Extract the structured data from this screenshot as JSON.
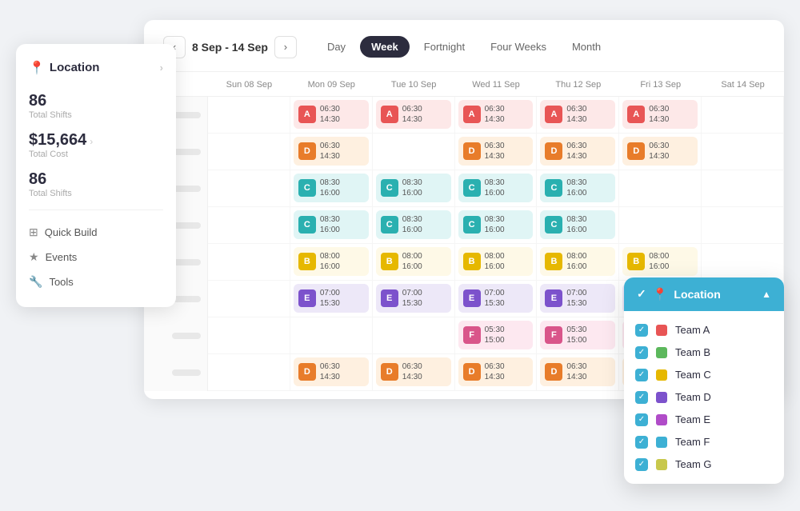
{
  "nav": {
    "dateRange": "8 Sep - 14 Sep",
    "views": [
      "Day",
      "Week",
      "Fortnight",
      "Four Weeks",
      "Month"
    ],
    "activeView": "Week"
  },
  "days": [
    {
      "label": "Sun 08 Sep"
    },
    {
      "label": "Mon 09 Sep"
    },
    {
      "label": "Tue 10 Sep"
    },
    {
      "label": "Wed 11 Sep"
    },
    {
      "label": "Thu 12 Sep"
    },
    {
      "label": "Fri 13 Sep"
    },
    {
      "label": "Sat 14 Sep"
    }
  ],
  "sidebar": {
    "location": "Location",
    "stats": [
      {
        "value": "86",
        "label": "Total Shifts"
      },
      {
        "value": "$15,664",
        "label": "Total Cost"
      },
      {
        "value": "86",
        "label": "Total Shifts"
      }
    ],
    "menu": [
      {
        "icon": "⊞",
        "label": "Quick Build"
      },
      {
        "icon": "★",
        "label": "Events"
      },
      {
        "icon": "🔧",
        "label": "Tools"
      }
    ]
  },
  "dropdown": {
    "header": "Location",
    "teams": [
      {
        "id": "A",
        "label": "Team A",
        "color": "#e85555",
        "checked": true
      },
      {
        "id": "B",
        "label": "Team B",
        "color": "#e6b800",
        "checked": true
      },
      {
        "id": "C",
        "label": "Team C",
        "color": "#2ab0b0",
        "checked": true
      },
      {
        "id": "D",
        "label": "Team D",
        "color": "#7c52cc",
        "checked": true
      },
      {
        "id": "E",
        "label": "Team E",
        "color": "#b04cc8",
        "checked": true
      },
      {
        "id": "F",
        "label": "Team F",
        "color": "#3db0d4",
        "checked": true
      },
      {
        "id": "G",
        "label": "Team G",
        "color": "#c8c84c",
        "checked": true
      }
    ]
  }
}
